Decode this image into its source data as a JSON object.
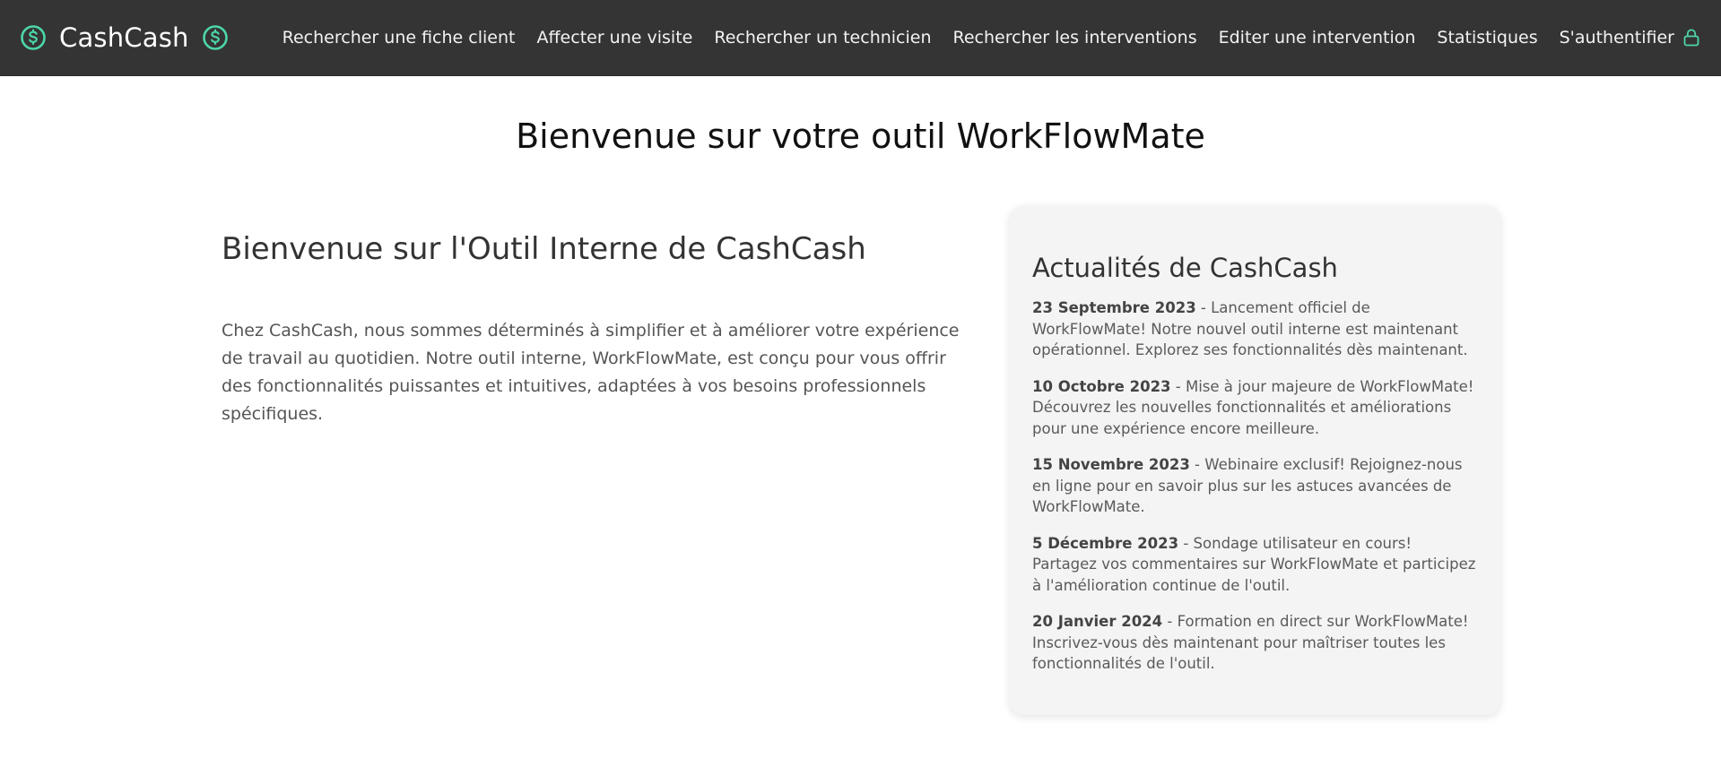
{
  "colors": {
    "navbar_bg": "#343434",
    "accent": "#4cd6a6",
    "card_bg": "#f4f4f4"
  },
  "navbar": {
    "brand": "CashCash",
    "brand_icons": [
      "dollar-circle-icon",
      "dollar-circle-icon"
    ],
    "links": [
      "Rechercher une fiche client",
      "Affecter une visite",
      "Rechercher un technicien",
      "Rechercher les interventions",
      "Editer une intervention",
      "Statistiques"
    ],
    "login_label": "S'authentifier",
    "login_icon": "lock-icon"
  },
  "main": {
    "title": "Bienvenue sur votre outil WorkFlowMate",
    "intro_heading": "Bienvenue sur l'Outil Interne de CashCash",
    "intro_text": "Chez CashCash, nous sommes déterminés à simplifier et à améliorer votre expérience de travail au quotidien. Notre outil interne, WorkFlowMate, est conçu pour vous offrir des fonctionnalités puissantes et intuitives, adaptées à vos besoins professionnels spécifiques."
  },
  "news": {
    "heading": "Actualités de CashCash",
    "items": [
      {
        "date": "23 Septembre 2023",
        "text": " - Lancement officiel de WorkFlowMate! Notre nouvel outil interne est maintenant opérationnel. Explorez ses fonctionnalités dès maintenant."
      },
      {
        "date": "10 Octobre 2023",
        "text": " - Mise à jour majeure de WorkFlowMate! Découvrez les nouvelles fonctionnalités et améliorations pour une expérience encore meilleure."
      },
      {
        "date": "15 Novembre 2023",
        "text": " - Webinaire exclusif! Rejoignez-nous en ligne pour en savoir plus sur les astuces avancées de WorkFlowMate."
      },
      {
        "date": "5 Décembre 2023",
        "text": " - Sondage utilisateur en cours! Partagez vos commentaires sur WorkFlowMate et participez à l'amélioration continue de l'outil."
      },
      {
        "date": "20 Janvier 2024",
        "text": " - Formation en direct sur WorkFlowMate! Inscrivez-vous dès maintenant pour maîtriser toutes les fonctionnalités de l'outil."
      }
    ]
  }
}
